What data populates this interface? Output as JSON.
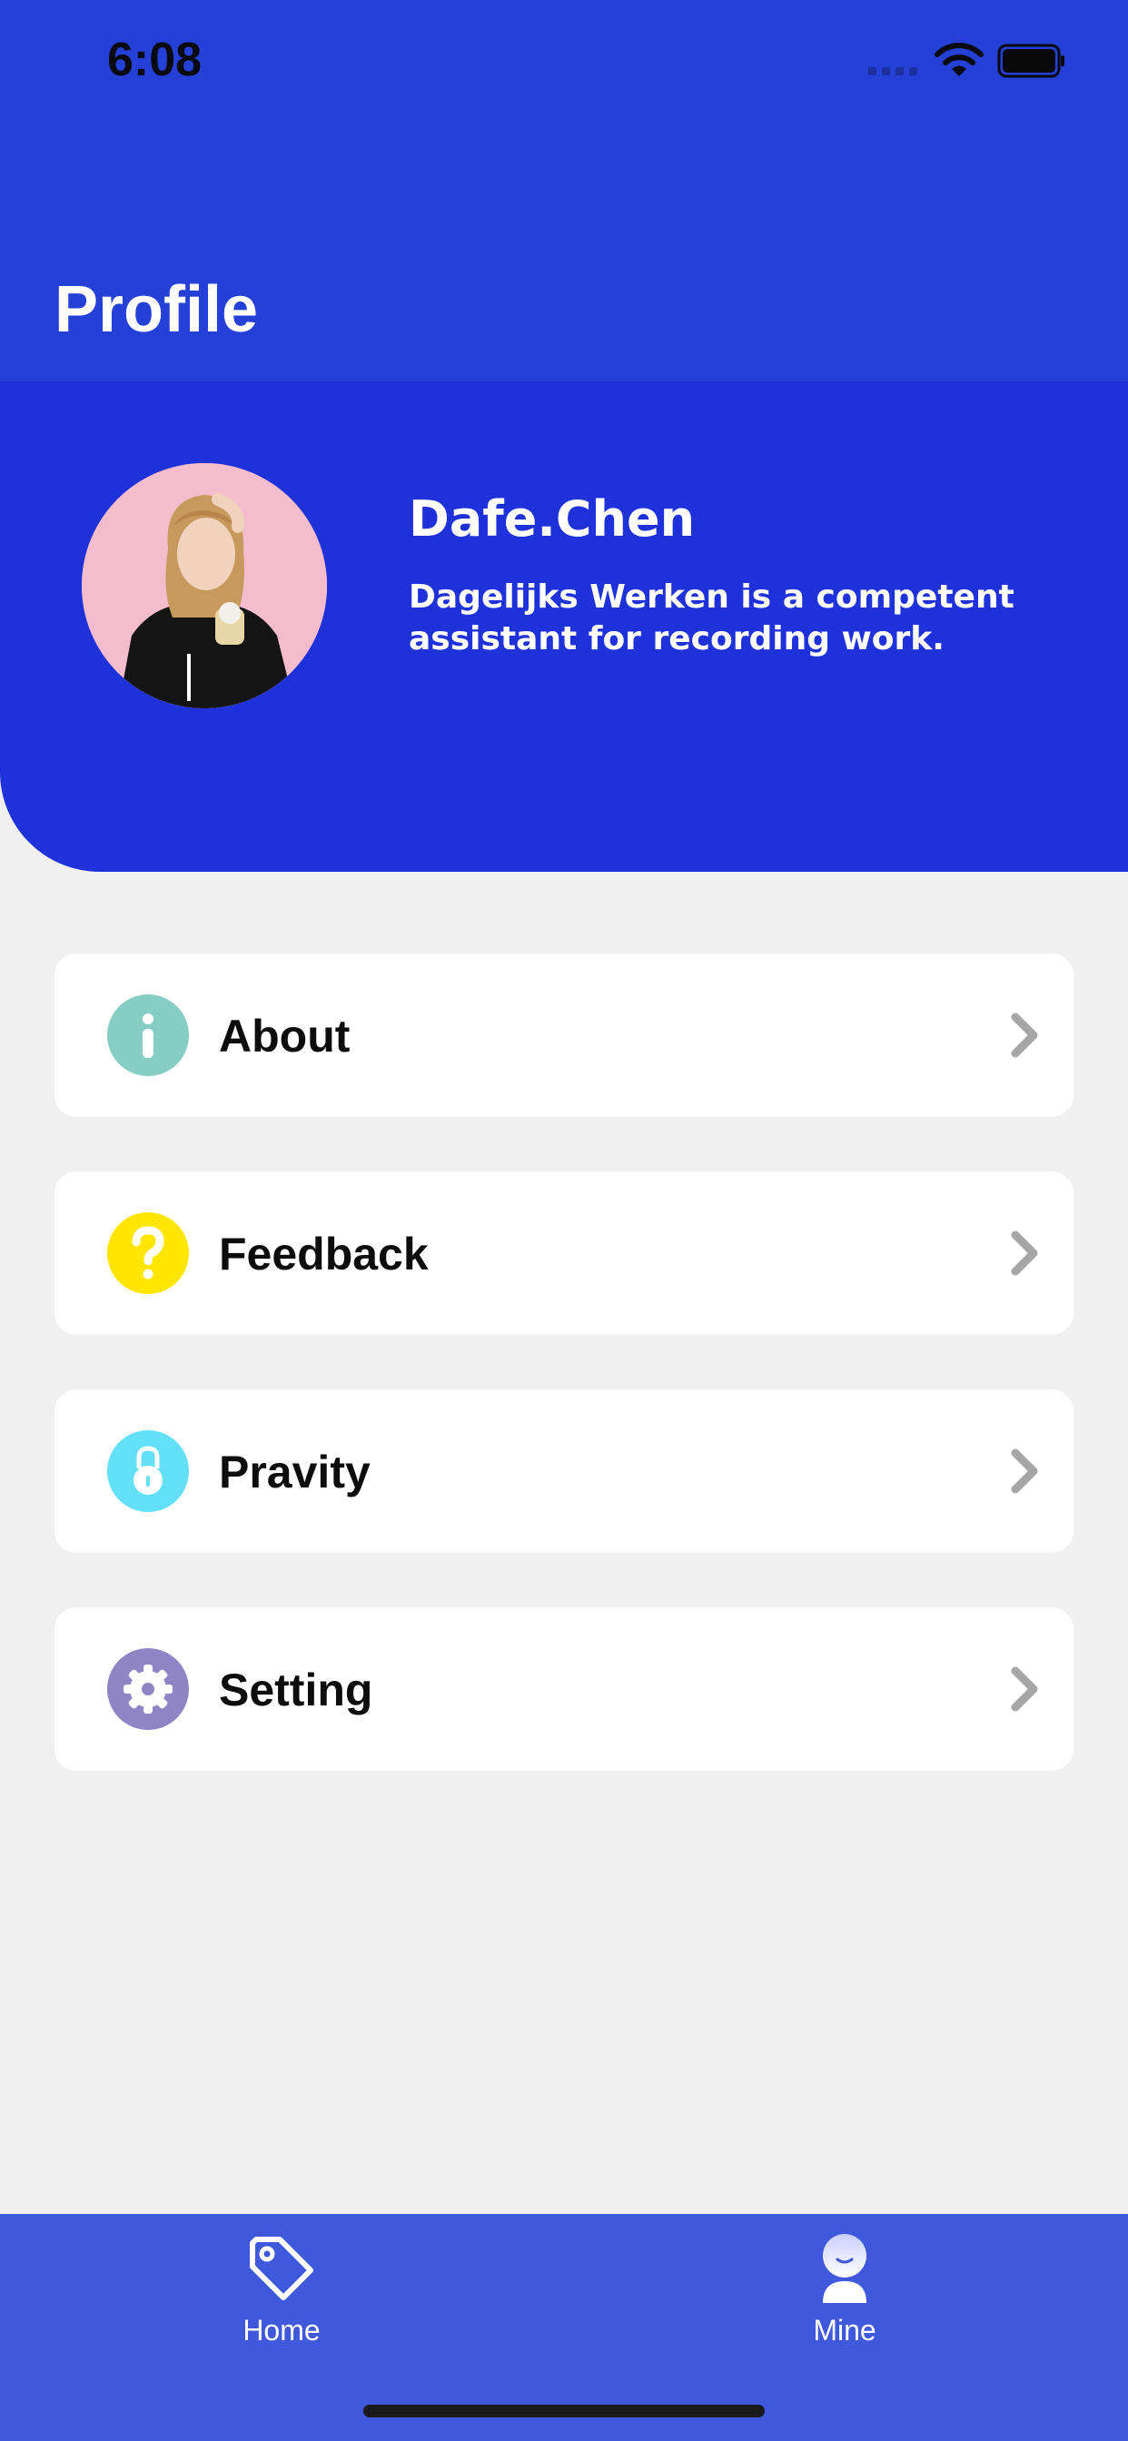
{
  "status_bar": {
    "time": "6:08"
  },
  "header": {
    "title": "Profile"
  },
  "profile": {
    "name": "Dafe.Chen",
    "description": "Dagelijks Werken is a competent assistant for recording work."
  },
  "menu": {
    "items": [
      {
        "label": "About",
        "icon": "info-icon",
        "color": "#86cdc4"
      },
      {
        "label": "Feedback",
        "icon": "question-icon",
        "color": "#ffe600"
      },
      {
        "label": "Pravity",
        "icon": "lock-icon",
        "color": "#63e0f8"
      },
      {
        "label": "Setting",
        "icon": "gear-icon",
        "color": "#8f84c4"
      }
    ]
  },
  "tab_bar": {
    "tabs": [
      {
        "label": "Home",
        "icon": "tag-icon"
      },
      {
        "label": "Mine",
        "icon": "person-icon"
      }
    ]
  },
  "colors": {
    "header": "#2440d6",
    "profile_card": "#1f32da",
    "tab_bar": "#3f58dc",
    "background": "#f0f0f0"
  }
}
